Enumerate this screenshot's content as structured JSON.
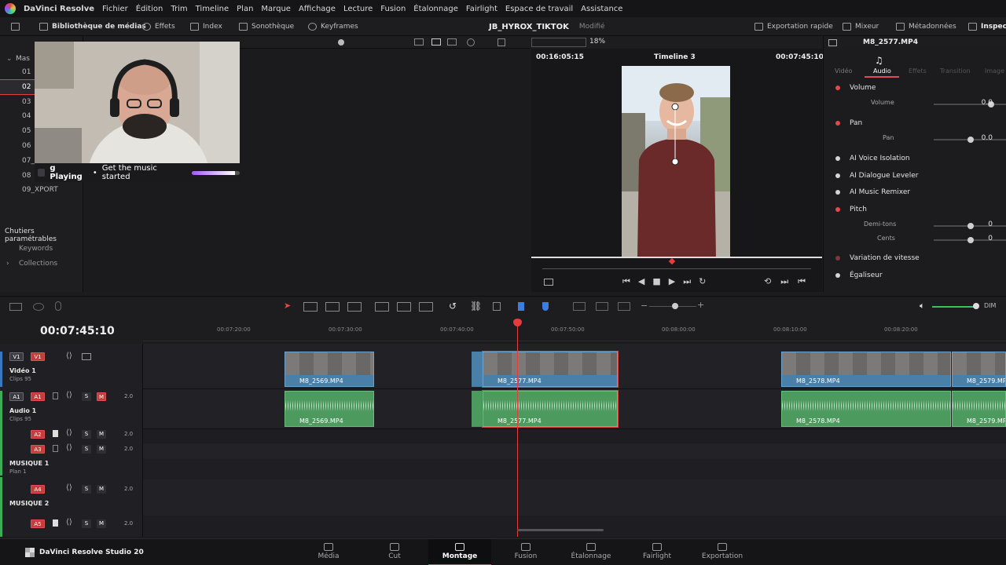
{
  "menubar": {
    "app": "DaVinci Resolve",
    "items": [
      "Fichier",
      "Édition",
      "Trim",
      "Timeline",
      "Plan",
      "Marque",
      "Affichage",
      "Lecture",
      "Fusion",
      "Étalonnage",
      "Fairlight",
      "Espace de travail",
      "Assistance"
    ]
  },
  "toolbar": {
    "media_library": "Bibliothèque de médias",
    "effects": "Effets",
    "index": "Index",
    "sound_library": "Sonothèque",
    "keyframes": "Keyframes",
    "project_name": "JB_HYROX_TIKTOK",
    "modified": "Modifié",
    "quick_export": "Exportation rapide",
    "mixer": "Mixeur",
    "metadata": "Métadonnées",
    "inspector": "Inspect"
  },
  "left_panel": {
    "master": "Mas",
    "bins": [
      "01",
      "02",
      "03",
      "04",
      "05",
      "06",
      "07_VIDEOS",
      "08",
      "09_XPORT"
    ],
    "smart_bins_title": "Chutiers paramétrables",
    "smart_bins": [
      "Keywords",
      "Collections"
    ]
  },
  "now_playing": {
    "label": "g Playing",
    "text": "Get the music started",
    "progress": 0.9
  },
  "viewer": {
    "zoom": "18%",
    "source_timecode": "00:16:05:15",
    "timeline_name": "Timeline 3",
    "record_timecode": "00:07:45:10"
  },
  "inspector": {
    "clip_name": "M8_2577.MP4",
    "tabs": [
      "Vidéo",
      "Audio",
      "Effets",
      "Transition",
      "Image"
    ],
    "active_tab": "Audio",
    "sections": {
      "volume": "Volume",
      "volume_param": "Volume",
      "volume_value": "0.0",
      "volume_level": 0.8,
      "pan": "Pan",
      "pan_param": "Pan",
      "pan_value": "0.0",
      "pan_level": 0.5,
      "ai_voice": "AI Voice Isolation",
      "ai_dialogue": "AI Dialogue Leveler",
      "ai_music": "AI Music Remixer",
      "pitch": "Pitch",
      "semitones": "Demi-tons",
      "semitones_value": "0",
      "semitones_level": 0.5,
      "cents": "Cents",
      "cents_value": "0",
      "cents_level": 0.5,
      "speed": "Variation de vitesse",
      "eq": "Égaliseur"
    }
  },
  "timeline": {
    "timecode": "00:07:45:10",
    "audio_meter": "DIM",
    "ruler": [
      "00:07:20:00",
      "00:07:30:00",
      "00:07:40:00",
      "00:07:50:00",
      "00:08:00:00",
      "00:08:10:00",
      "00:08:20:00"
    ],
    "tracks": {
      "v1": {
        "name": "Vidéo 1",
        "sub": "Clips 95",
        "chip1": "V1",
        "chip2": "V1"
      },
      "a1": {
        "name": "Audio 1",
        "sub": "Clips 95",
        "chip1": "A1",
        "chip2": "A1",
        "level": "2.0"
      },
      "a2": {
        "chip": "A2",
        "level": "2.0"
      },
      "a3": {
        "chip": "A3",
        "level": "2.0"
      },
      "musique1": {
        "name": "MUSIQUE 1",
        "sub": "Plan 1"
      },
      "a4": {
        "chip": "A4",
        "level": "2.0"
      },
      "musique2": {
        "name": "MUSIQUE 2"
      },
      "a5": {
        "chip": "A5",
        "level": "2.0"
      },
      "solo": "S",
      "mute": "M"
    },
    "video_clips": [
      "M8_2569.MP4",
      "M8_2577.MP4",
      "M8_2578.MP4",
      "M8_2579.MP4"
    ],
    "audio_clips": [
      "M8_2569.MP4",
      "M8_2577.MP4",
      "M8_2578.MP4",
      "M8_2579.MP4"
    ]
  },
  "bottombar": {
    "brand": "DaVinci Resolve Studio 20",
    "pages": [
      "Média",
      "Cut",
      "Montage",
      "Fusion",
      "Étalonnage",
      "Fairlight",
      "Exportation"
    ],
    "active_page": "Montage"
  },
  "colors": {
    "accent_red": "#e04a4a",
    "video_clip": "#4a7fa8",
    "audio_clip": "#4c9a5e",
    "playhead": "#e83c3c"
  }
}
